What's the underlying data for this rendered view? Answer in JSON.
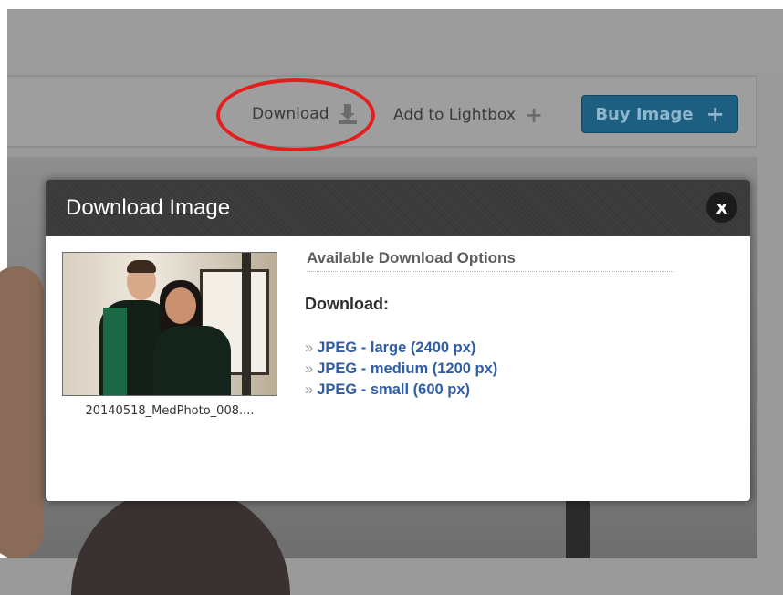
{
  "toolbar": {
    "download_label": "Download",
    "lightbox_label": "Add to Lightbox",
    "buy_label": "Buy Image"
  },
  "modal": {
    "title": "Download Image",
    "close_label": "x",
    "thumbnail_caption": "20140518_MedPhoto_008....",
    "options_heading": "Available Download Options",
    "download_heading": "Download:",
    "options": [
      {
        "label": "JPEG - large (2400 px)"
      },
      {
        "label": "JPEG - medium (1200 px)"
      },
      {
        "label": "JPEG - small (600 px)"
      }
    ]
  },
  "colors": {
    "buy_button": "#1c5f80",
    "link": "#2f5da8",
    "annotation_circle": "#e41d1d",
    "modal_header": "#3c3c3c"
  },
  "icons": [
    "download-icon",
    "plus-icon",
    "close-icon",
    "chevron-right-icon"
  ]
}
